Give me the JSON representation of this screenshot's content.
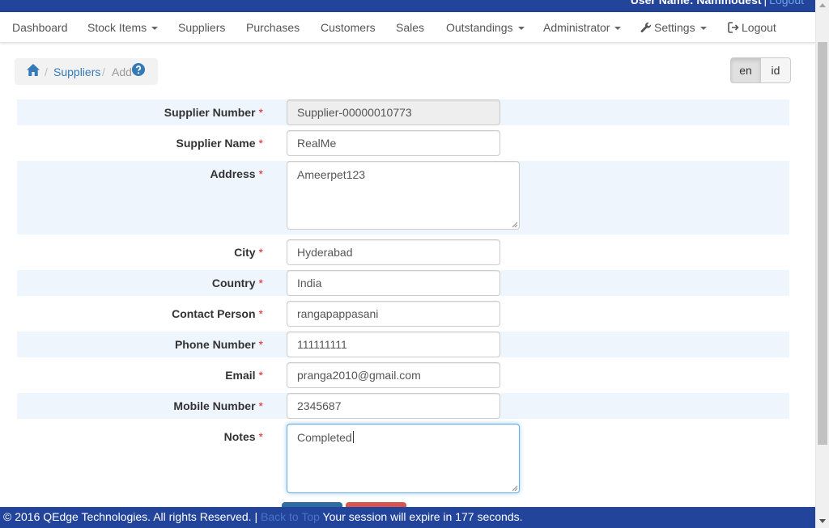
{
  "topbar": {
    "user_text": "User Name: Nammodest",
    "separator": "|",
    "logout_link": "Logout"
  },
  "nav": {
    "dashboard": "Dashboard",
    "stock_items": "Stock Items",
    "suppliers": "Suppliers",
    "purchases": "Purchases",
    "customers": "Customers",
    "sales": "Sales",
    "outstandings": "Outstandings",
    "administrator": "Administrator",
    "settings": "Settings",
    "logout": "Logout"
  },
  "breadcrumb": {
    "sep": "/",
    "suppliers": "Suppliers",
    "current": "Add"
  },
  "language": {
    "en": "en",
    "id": "id"
  },
  "form": {
    "required_mark": "*",
    "supplier_number": {
      "label": "Supplier Number",
      "value": "Supplier-00000010773"
    },
    "supplier_name": {
      "label": "Supplier Name",
      "value": "RealMe"
    },
    "address": {
      "label": "Address",
      "value": "Ameerpet123"
    },
    "city": {
      "label": "City",
      "value": "Hyderabad"
    },
    "country": {
      "label": "Country",
      "value": "India"
    },
    "contact_person": {
      "label": "Contact Person",
      "value": "rangapappasani"
    },
    "phone_number": {
      "label": "Phone Number",
      "value": "111111111"
    },
    "email": {
      "label": "Email",
      "value": "pranga2010@gmail.com"
    },
    "mobile_number": {
      "label": "Mobile Number",
      "value": "2345687"
    },
    "notes": {
      "label": "Notes",
      "value": "Completed"
    }
  },
  "footer": {
    "copyright": "© 2016 QEdge Technologies. All rights Reserved. |",
    "back_to_top": "Back to Top",
    "session": "Your session will expire in 177 seconds."
  },
  "colors": {
    "brand_bar": "#22449a",
    "link": "#337ab7",
    "row_shade": "#eef5fd",
    "required": "#d9272e"
  },
  "icons": [
    "home-icon",
    "help-icon",
    "wrench-icon",
    "logout-icon",
    "caret-down-icon"
  ]
}
